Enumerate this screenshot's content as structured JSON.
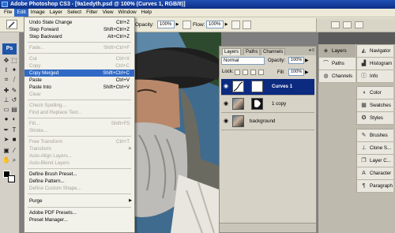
{
  "window": {
    "title": "Adobe Photoshop CS3 - [9a1edyth.psd @ 100% (Curves 1, RGB/8)]"
  },
  "menubar": {
    "items": [
      "File",
      "Edit",
      "Image",
      "Layer",
      "Select",
      "Filter",
      "View",
      "Window",
      "Help"
    ],
    "active": "Edit"
  },
  "options": {
    "opacity_label": "Opacity:",
    "opacity_value": "100%",
    "flow_label": "Flow:",
    "flow_value": "100%"
  },
  "toolbox": {
    "logo": "Ps"
  },
  "edit_menu": {
    "items": [
      {
        "label": "Undo State Change",
        "shortcut": "Ctrl+Z",
        "enabled": true
      },
      {
        "label": "Step Forward",
        "shortcut": "Shift+Ctrl+Z",
        "enabled": true
      },
      {
        "label": "Step Backward",
        "shortcut": "Alt+Ctrl+Z",
        "enabled": true
      },
      {
        "label": "Fade...",
        "shortcut": "Shift+Ctrl+F",
        "enabled": false
      },
      {
        "label": "Cut",
        "shortcut": "Ctrl+X",
        "enabled": false
      },
      {
        "label": "Copy",
        "shortcut": "Ctrl+C",
        "enabled": false
      },
      {
        "label": "Copy Merged",
        "shortcut": "Shift+Ctrl+C",
        "enabled": true,
        "highlighted": true
      },
      {
        "label": "Paste",
        "shortcut": "Ctrl+V",
        "enabled": true
      },
      {
        "label": "Paste Into",
        "shortcut": "Shift+Ctrl+V",
        "enabled": true
      },
      {
        "label": "Clear",
        "shortcut": "",
        "enabled": false
      },
      {
        "label": "Check Spelling...",
        "shortcut": "",
        "enabled": false
      },
      {
        "label": "Find and Replace Text...",
        "shortcut": "",
        "enabled": false
      },
      {
        "label": "Fill...",
        "shortcut": "Shift+F5",
        "enabled": false
      },
      {
        "label": "Stroke...",
        "shortcut": "",
        "enabled": false
      },
      {
        "label": "Free Transform",
        "shortcut": "Ctrl+T",
        "enabled": false
      },
      {
        "label": "Transform",
        "shortcut": "",
        "enabled": false
      },
      {
        "label": "Auto-Align Layers...",
        "shortcut": "",
        "enabled": false
      },
      {
        "label": "Auto-Blend Layers",
        "shortcut": "",
        "enabled": false
      },
      {
        "label": "Define Brush Preset...",
        "shortcut": "",
        "enabled": true
      },
      {
        "label": "Define Pattern...",
        "shortcut": "",
        "enabled": true
      },
      {
        "label": "Define Custom Shape...",
        "shortcut": "",
        "enabled": false
      },
      {
        "label": "Purge",
        "shortcut": "",
        "enabled": true
      },
      {
        "label": "Adobe PDF Presets...",
        "shortcut": "",
        "enabled": true
      },
      {
        "label": "Preset Manager...",
        "shortcut": "",
        "enabled": true
      }
    ]
  },
  "layers_panel": {
    "tabs": [
      "Layers",
      "Paths",
      "Channels"
    ],
    "blend_mode": "Normal",
    "opacity_label": "Opacity:",
    "opacity_value": "100%",
    "lock_label": "Lock:",
    "fill_label": "Fill:",
    "fill_value": "100%",
    "layers": [
      {
        "name": "Curves 1",
        "selected": true
      },
      {
        "name": "1 copy",
        "selected": false
      },
      {
        "name": "background",
        "selected": false
      }
    ]
  },
  "dock": {
    "col1": [
      "Layers",
      "Paths",
      "Channels"
    ],
    "col2": [
      "Navigator",
      "Histogram",
      "Info",
      "Color",
      "Swatches",
      "Styles",
      "Brushes",
      "Clone S...",
      "Layer C...",
      "Character",
      "Paragraph"
    ]
  }
}
